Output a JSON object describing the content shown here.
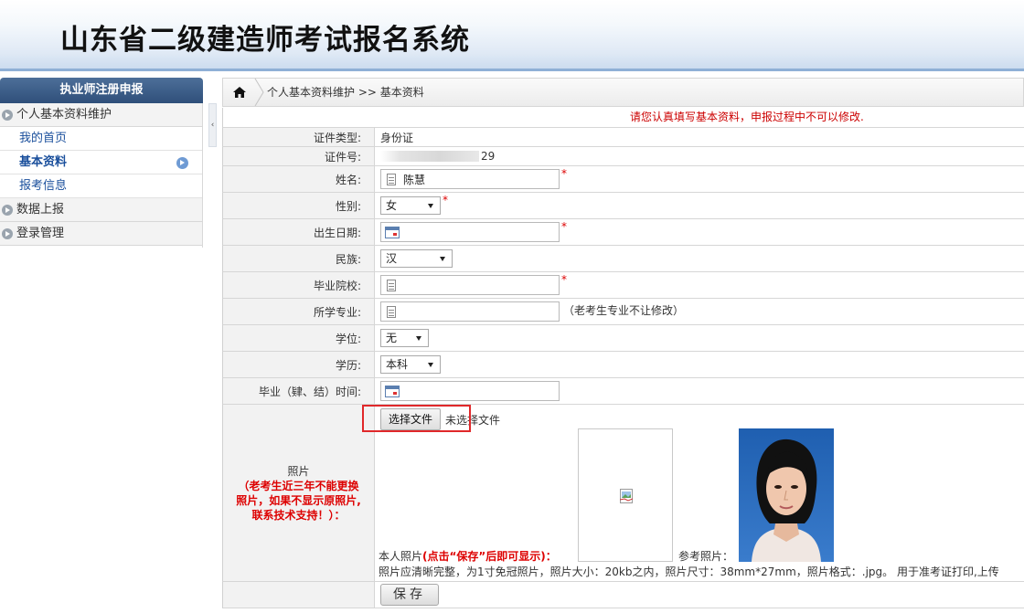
{
  "header": {
    "title": "山东省二级建造师考试报名系统"
  },
  "sidebar": {
    "heading": "执业师注册申报",
    "groups": [
      {
        "label": "个人基本资料维护",
        "items": [
          {
            "label": "我的首页"
          },
          {
            "label": "基本资料"
          },
          {
            "label": "报考信息"
          }
        ]
      },
      {
        "label": "数据上报"
      },
      {
        "label": "登录管理"
      }
    ],
    "collapse_glyph": "‹"
  },
  "breadcrumb": {
    "text": "个人基本资料维护 >> 基本资料"
  },
  "form": {
    "notice": "请您认真填写基本资料，申报过程中不可以修改.",
    "fields": {
      "id_type": {
        "label": "证件类型:",
        "value": "身份证"
      },
      "id_number": {
        "label": "证件号:",
        "value_suffix": "29"
      },
      "name": {
        "label": "姓名:",
        "value": "陈慧"
      },
      "gender": {
        "label": "性别:",
        "value": "女"
      },
      "birth_date": {
        "label": "出生日期:",
        "value": ""
      },
      "ethnicity": {
        "label": "民族:",
        "value": "汉"
      },
      "school": {
        "label": "毕业院校:",
        "value": ""
      },
      "major": {
        "label": "所学专业:",
        "value": "",
        "hint": "（老考生专业不让修改）"
      },
      "degree": {
        "label": "学位:",
        "value": "无"
      },
      "education": {
        "label": "学历:",
        "value": "本科"
      },
      "graduation_time": {
        "label": "毕业（肄、结）时间:",
        "value": ""
      }
    },
    "required_mark": "*",
    "photo": {
      "label": "照片",
      "warning": "（老考生近三年不能更换照片，如果不显示原照片,联系技术支持！）：",
      "file_button": "选择文件",
      "file_status": "未选择文件",
      "own_photo_label": "本人照片",
      "own_photo_hint": "(点击“保存”后即可显示)：",
      "ref_photo_label": "参考照片：",
      "requirements": "照片应清晰完整，为1寸免冠照片，照片大小：20kb之内，照片尺寸：38mm*27mm，照片格式：.jpg。 用于准考证打印,上传"
    },
    "save_label": "保存"
  },
  "colors": {
    "accent": "#2f4f7a",
    "warning": "#cc0000",
    "link": "#1a4f9c",
    "highlight_box": "#e0282a"
  }
}
